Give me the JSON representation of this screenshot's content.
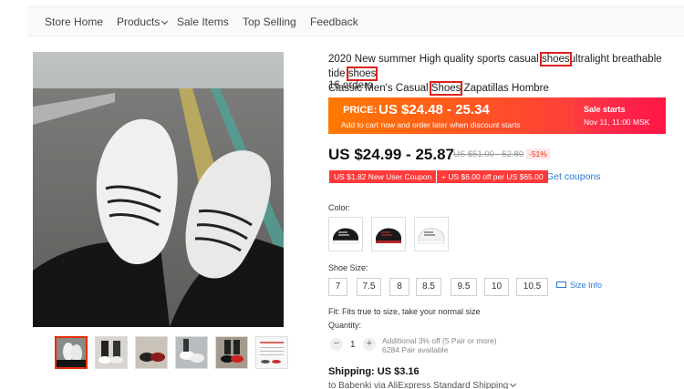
{
  "nav": {
    "items": [
      {
        "label": "Store Home"
      },
      {
        "label": "Products"
      },
      {
        "label": "Sale Items"
      },
      {
        "label": "Top Selling"
      },
      {
        "label": "Feedback"
      }
    ]
  },
  "product": {
    "title_parts": [
      "2020 New summer High quality sports casual",
      "shoes",
      "ultralight breathable tide",
      "shoes",
      "Classic Men's Casual",
      "Shoes",
      "Zapatillas Hombre"
    ],
    "orders": "16 orders"
  },
  "promo": {
    "price_label": "PRICE:",
    "price": "US $24.48 - 25.34",
    "sub": "Add to cart now and order later when discount starts",
    "sale_label": "Sale starts",
    "sale_date": "Nov 11, 11:00 MSK"
  },
  "price": {
    "current": "US $24.99 - 25.87",
    "original": "US $51.00 - 52.80",
    "discount": "-51%"
  },
  "coupons": {
    "new_user": "US $1.82 New User Coupon",
    "store": "+ US $6.00 off per US $65.00",
    "get": "Get coupons"
  },
  "color": {
    "label": "Color:",
    "options": [
      "black-white",
      "black-red",
      "white"
    ]
  },
  "size": {
    "label": "Shoe Size:",
    "options": [
      "7",
      "7.5",
      "8",
      "8.5",
      "9.5",
      "10",
      "10.5"
    ],
    "info": "Size Info"
  },
  "fit": "Fit: Fits true to size, take your normal size",
  "quantity": {
    "label": "Quantity:",
    "minus": "−",
    "value": "1",
    "plus": "+",
    "note1": "Additional 3% off (5 Pair or more)",
    "note2": "6284 Pair available"
  },
  "shipping": {
    "label": "Shipping: US $3.16",
    "via": "to Babenki via AliExpress Standard Shipping"
  },
  "colors": {
    "accent": "#e62e04",
    "link": "#2a78d4",
    "highlight": "#e02020"
  }
}
